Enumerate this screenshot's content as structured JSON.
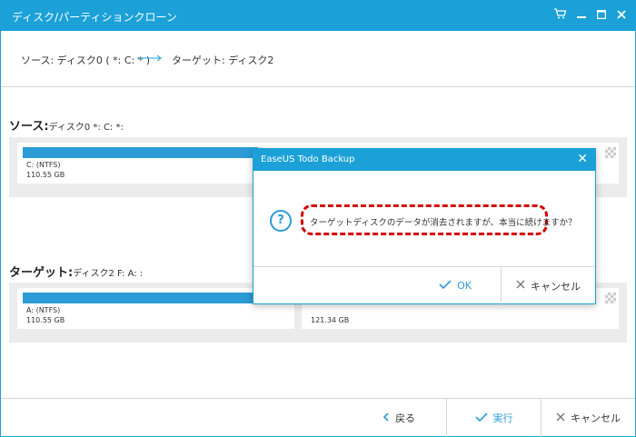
{
  "window": {
    "title": "ディスク/パーティションクローン"
  },
  "crumb": {
    "source": "ソース:  ディスク0 ( *: C: * )",
    "target": "ターゲット:  ディスク2"
  },
  "source_section": {
    "label_bold": "ソース:",
    "label_rest": "ディスク0 *: C: *:",
    "partition": {
      "name": "C: (NTFS)",
      "size": "110.55 GB",
      "used_fraction": 0.98
    }
  },
  "target_section": {
    "label_bold": "ターゲット:",
    "label_rest": "ディスク2 F: A: :",
    "partition_a": {
      "name": "A: (NTFS)",
      "size": "110.55 GB",
      "used_fraction": 0.98
    },
    "partition_b": {
      "size": "121.34 GB"
    }
  },
  "footer": {
    "back_label": "戻る",
    "execute_label": "実行",
    "cancel_label": "キャンセル"
  },
  "dialog": {
    "title": "EaseUS Todo Backup",
    "message": "ターゲットディスクのデータが消去されますが、本当に続けますか？",
    "ok_label": "OK",
    "cancel_label": "キャンセル"
  },
  "colors": {
    "accent": "#1ba1d8",
    "bar": "#2c9bd6",
    "highlight": "#d40000"
  }
}
